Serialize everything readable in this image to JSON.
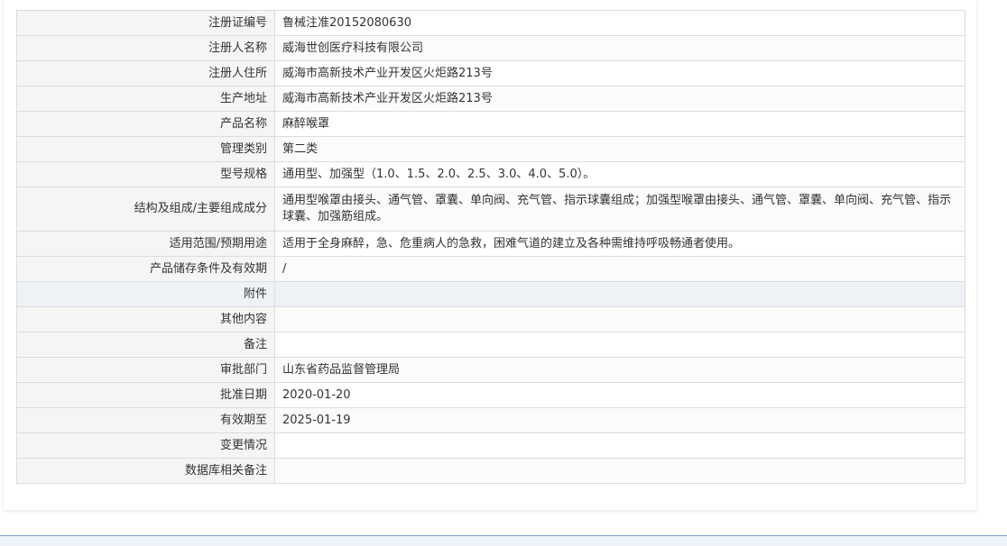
{
  "rows": [
    {
      "label": "注册证编号",
      "value": "鲁械注准20152080630"
    },
    {
      "label": "注册人名称",
      "value": "威海世创医疗科技有限公司"
    },
    {
      "label": "注册人住所",
      "value": "威海市高新技术产业开发区火炬路213号"
    },
    {
      "label": "生产地址",
      "value": "威海市高新技术产业开发区火炬路213号"
    },
    {
      "label": "产品名称",
      "value": "麻醉喉罩"
    },
    {
      "label": "管理类别",
      "value": "第二类"
    },
    {
      "label": "型号规格",
      "value": "通用型、加强型（1.0、1.5、2.0、2.5、3.0、4.0、5.0）。"
    },
    {
      "label": "结构及组成/主要组成成分",
      "value": "通用型喉罩由接头、通气管、罩囊、单向阀、充气管、指示球囊组成；加强型喉罩由接头、通气管、罩囊、单向阀、充气管、指示球囊、加强筋组成。"
    },
    {
      "label": "适用范围/预期用途",
      "value": "适用于全身麻醉，急、危重病人的急救，困难气道的建立及各种需维持呼吸畅通者使用。"
    },
    {
      "label": "产品储存条件及有效期",
      "value": "/"
    },
    {
      "label": "附件",
      "value": ""
    },
    {
      "label": "其他内容",
      "value": ""
    },
    {
      "label": "备注",
      "value": ""
    },
    {
      "label": "审批部门",
      "value": "山东省药品监督管理局"
    },
    {
      "label": "批准日期",
      "value": "2020-01-20"
    },
    {
      "label": "有效期至",
      "value": "2025-01-19"
    },
    {
      "label": "变更情况",
      "value": ""
    },
    {
      "label": "数据库相关备注",
      "value": ""
    }
  ]
}
